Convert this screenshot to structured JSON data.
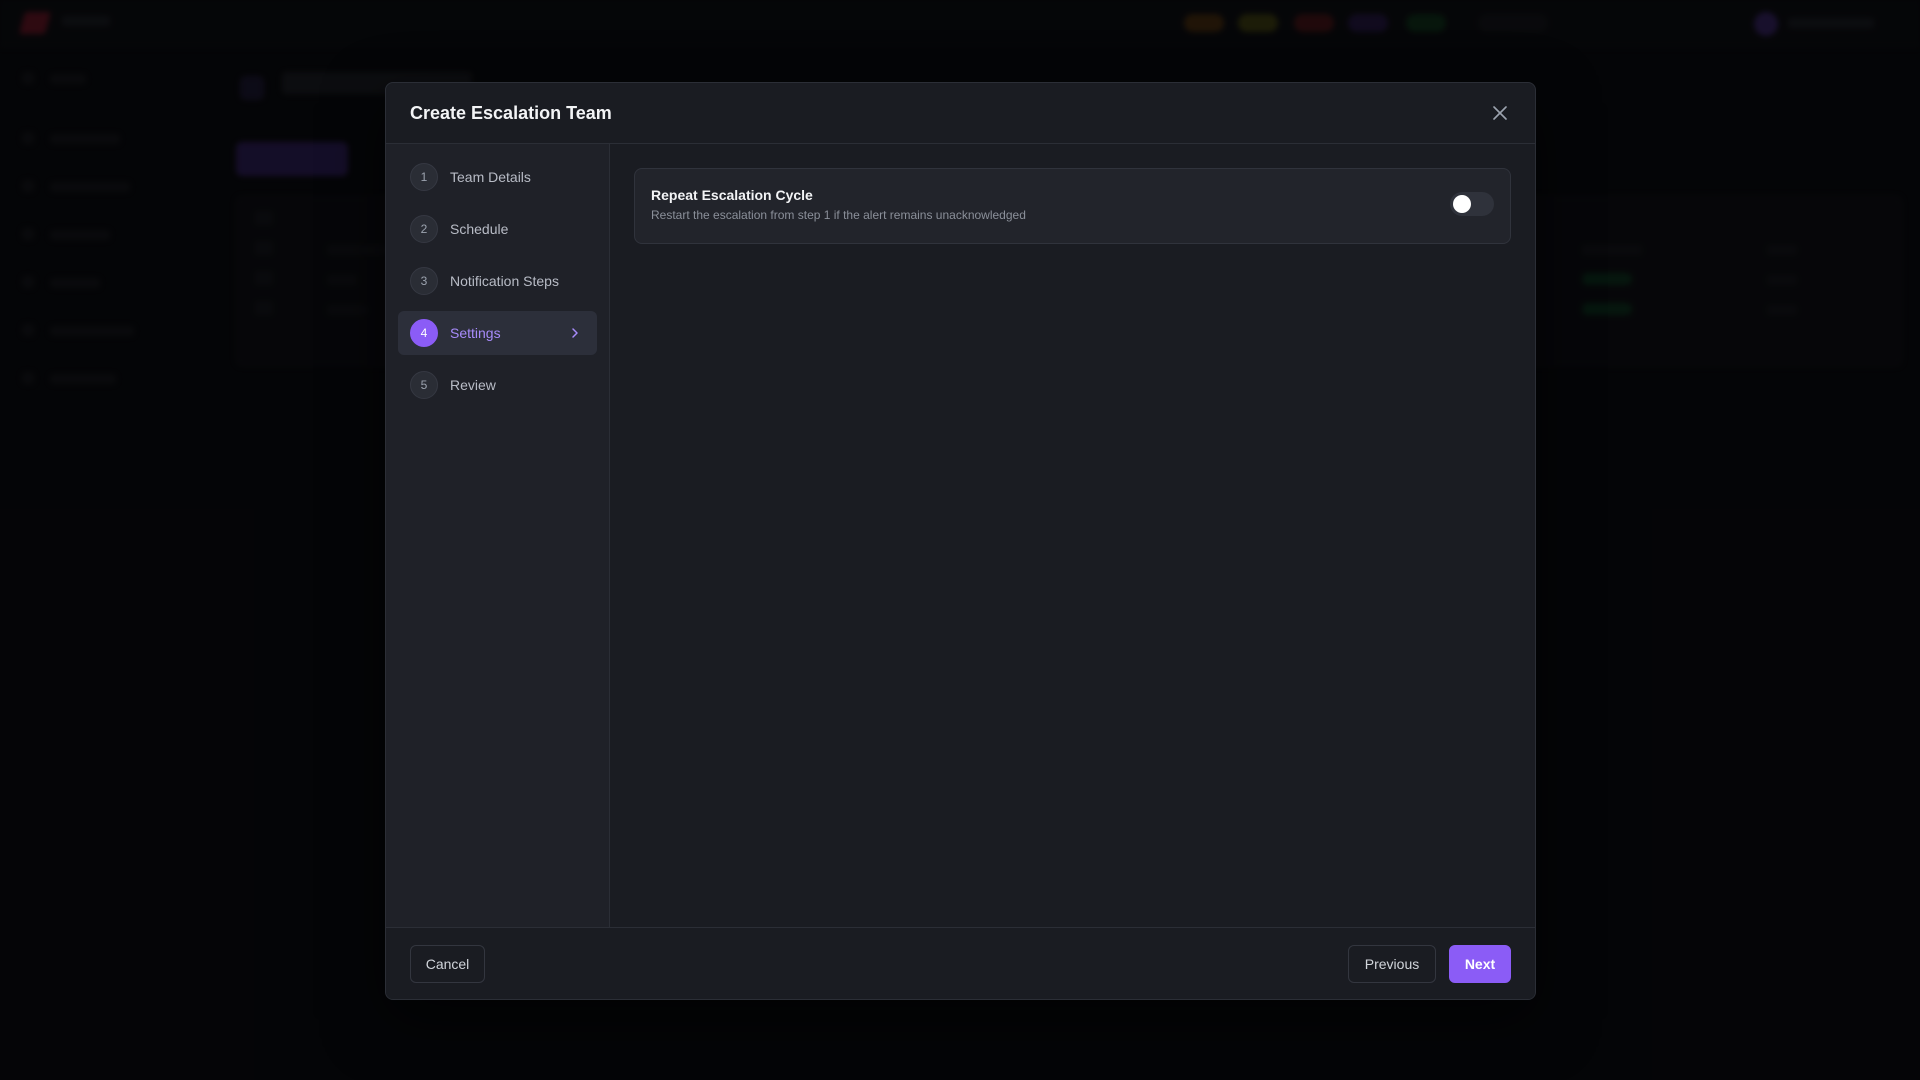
{
  "modal": {
    "title": "Create Escalation Team",
    "steps": [
      {
        "number": "1",
        "label": "Team Details"
      },
      {
        "number": "2",
        "label": "Schedule"
      },
      {
        "number": "3",
        "label": "Notification Steps"
      },
      {
        "number": "4",
        "label": "Settings"
      },
      {
        "number": "5",
        "label": "Review"
      }
    ],
    "active_step": "4",
    "setting": {
      "title": "Repeat Escalation Cycle",
      "description": "Restart the escalation from step 1 if the alert remains unacknowledged",
      "enabled": false
    },
    "footer": {
      "cancel_label": "Cancel",
      "previous_label": "Previous",
      "next_label": "Next"
    }
  },
  "colors": {
    "accent": "#8b5cf6",
    "modal_bg": "#1a1c22",
    "sidebar_bg": "#1f2128"
  },
  "icons": {
    "close": "close-icon",
    "active_step_chevron": "chevron-right-icon"
  }
}
